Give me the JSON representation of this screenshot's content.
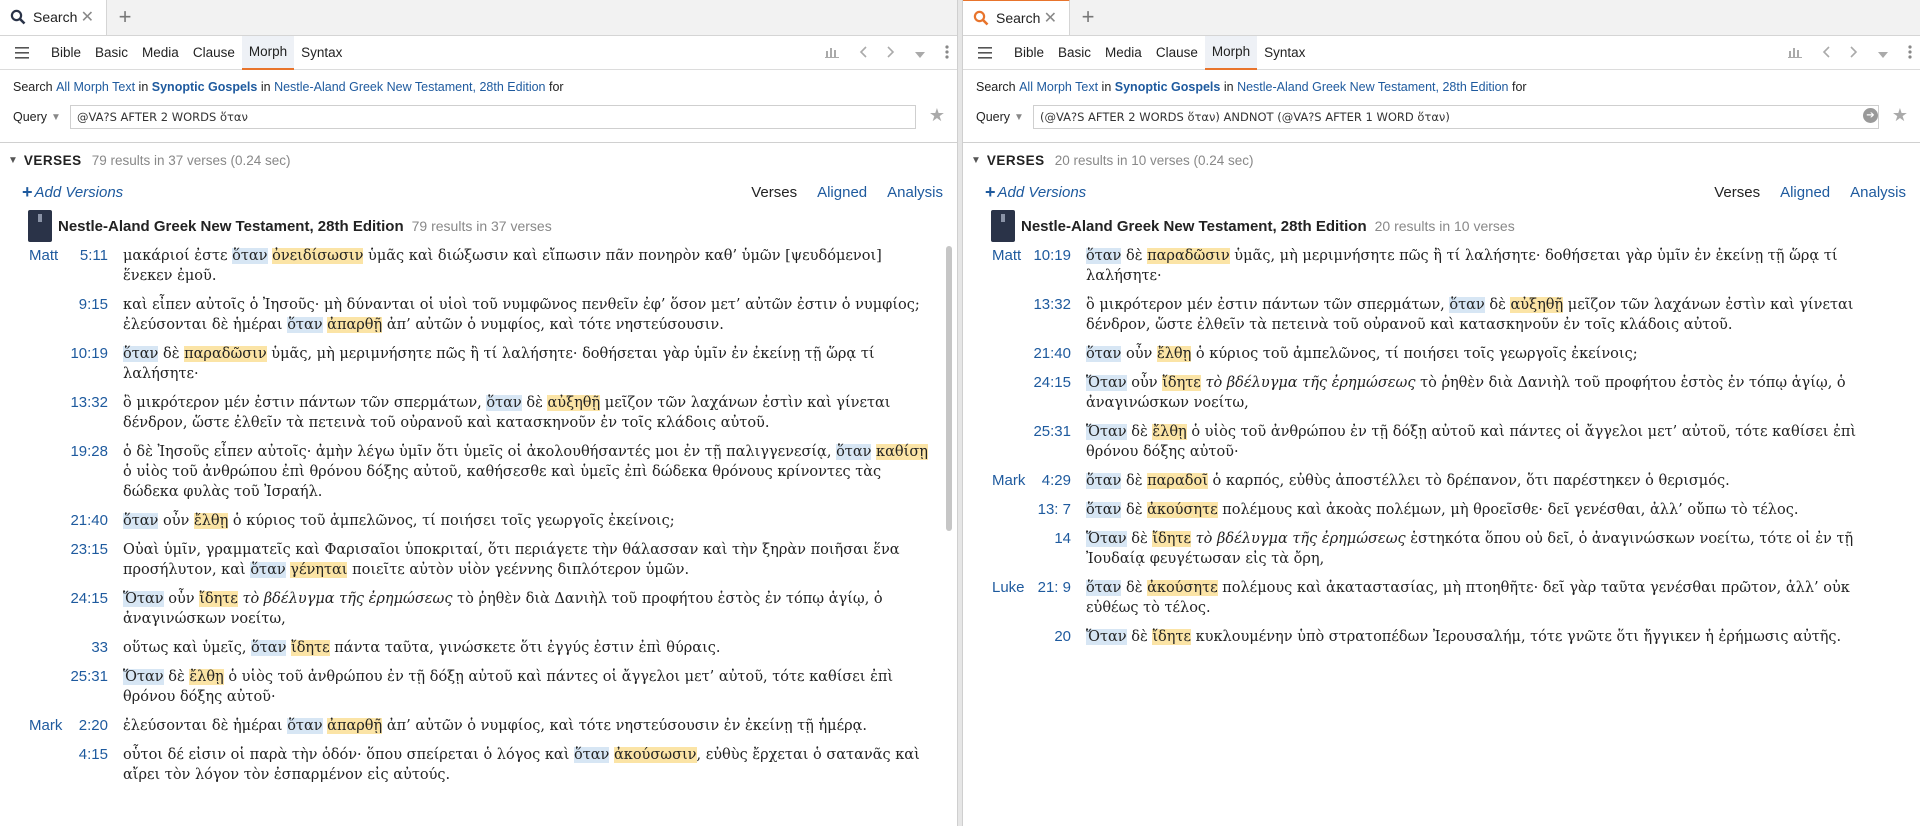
{
  "left": {
    "tab": {
      "label": "Search",
      "close": "✕",
      "new": "+"
    },
    "toolbar": {
      "tabs": [
        "Bible",
        "Basic",
        "Media",
        "Clause",
        "Morph",
        "Syntax"
      ],
      "active_tab": "Morph"
    },
    "search": {
      "prefix": "Search",
      "scope1": "All Morph Text",
      "in1": "in",
      "scope2": "Synoptic Gospels",
      "in2": "in",
      "scope3": "Nestle-Aland Greek New Testament, 28th Edition",
      "suffix": "for"
    },
    "query": {
      "label": "Query",
      "value": "@VA?S AFTER 2 WORDS ὅταν"
    },
    "section": {
      "title": "VERSES",
      "count": "79 results in 37 verses (0.24 sec)"
    },
    "versions": {
      "add": "Add Versions",
      "links": [
        "Verses",
        "Aligned",
        "Analysis"
      ]
    },
    "book": {
      "name": "Nestle-Aland Greek New Testament, 28th Edition",
      "count": "79 results in 37 verses"
    },
    "verses": [
      {
        "book": "Matt",
        "ref": "5:11",
        "parts": [
          [
            "μακάριοί ἐστε ",
            ""
          ],
          [
            "ὅταν",
            "b"
          ],
          [
            " ",
            ""
          ],
          [
            "ὀνειδίσωσιν",
            "y"
          ],
          [
            " ὑμᾶς καὶ διώξωσιν καὶ εἴπωσιν πᾶν πονηρὸν καθ’ ὑμῶν [ψευδόμενοι] ἕνεκεν ἐμοῦ.",
            ""
          ]
        ]
      },
      {
        "book": "",
        "ref": "9:15",
        "parts": [
          [
            "καὶ εἶπεν αὐτοῖς ὁ Ἰησοῦς· μὴ δύνανται οἱ υἱοὶ τοῦ νυμφῶνος πενθεῖν ἐφ’ ὅσον μετ’ αὐτῶν ἐστιν ὁ νυμφίος; ἐλεύσονται δὲ ἡμέραι ",
            ""
          ],
          [
            "ὅταν",
            "b"
          ],
          [
            " ",
            ""
          ],
          [
            "ἀπαρθῇ",
            "y"
          ],
          [
            " ἀπ’ αὐτῶν ὁ νυμφίος, καὶ τότε νηστεύσουσιν.",
            ""
          ]
        ]
      },
      {
        "book": "",
        "ref": "10:19",
        "parts": [
          [
            "ὅταν",
            "b"
          ],
          [
            " δὲ ",
            ""
          ],
          [
            "παραδῶσιν",
            "y"
          ],
          [
            " ὑμᾶς, μὴ μεριμνήσητε πῶς ἢ τί λαλήσητε· δοθήσεται γὰρ ὑμῖν ἐν ἐκείνῃ τῇ ὥρᾳ τί λαλήσητε·",
            ""
          ]
        ]
      },
      {
        "book": "",
        "ref": "13:32",
        "parts": [
          [
            "ὃ μικρότερον μέν ἐστιν πάντων τῶν σπερμάτων, ",
            ""
          ],
          [
            "ὅταν",
            "b"
          ],
          [
            " δὲ ",
            ""
          ],
          [
            "αὐξηθῇ",
            "y"
          ],
          [
            " μεῖζον τῶν λαχάνων ἐστὶν καὶ γίνεται δένδρον, ὥστε ἐλθεῖν τὰ πετεινὰ τοῦ οὐρανοῦ καὶ κατασκηνοῦν ἐν τοῖς κλάδοις αὐτοῦ.",
            ""
          ]
        ]
      },
      {
        "book": "",
        "ref": "19:28",
        "parts": [
          [
            "ὁ δὲ Ἰησοῦς εἶπεν αὐτοῖς· ἀμὴν λέγω ὑμῖν ὅτι ὑμεῖς οἱ ἀκολουθήσαντές μοι ἐν τῇ παλιγγενεσίᾳ, ",
            ""
          ],
          [
            "ὅταν",
            "b"
          ],
          [
            " ",
            ""
          ],
          [
            "καθίσῃ",
            "y"
          ],
          [
            " ὁ υἱὸς τοῦ ἀνθρώπου ἐπὶ θρόνου δόξης αὐτοῦ, καθήσεσθε καὶ ὑμεῖς ἐπὶ δώδεκα θρόνους κρίνοντες τὰς δώδεκα φυλὰς τοῦ Ἰσραήλ.",
            ""
          ]
        ]
      },
      {
        "book": "",
        "ref": "21:40",
        "parts": [
          [
            "ὅταν",
            "b"
          ],
          [
            " οὖν ",
            ""
          ],
          [
            "ἔλθῃ",
            "y"
          ],
          [
            " ὁ κύριος τοῦ ἀμπελῶνος, τί ποιήσει τοῖς γεωργοῖς ἐκείνοις;",
            ""
          ]
        ]
      },
      {
        "book": "",
        "ref": "23:15",
        "parts": [
          [
            "Οὐαὶ ὑμῖν, γραμματεῖς καὶ Φαρισαῖοι ὑποκριταί, ὅτι περιάγετε τὴν θάλασσαν καὶ τὴν ξηρὰν ποιῆσαι ἕνα προσήλυτον, καὶ ",
            ""
          ],
          [
            "ὅταν",
            "b"
          ],
          [
            " ",
            ""
          ],
          [
            "γένηται",
            "y"
          ],
          [
            " ποιεῖτε αὐτὸν υἱὸν γεέννης διπλότερον ὑμῶν.",
            ""
          ]
        ]
      },
      {
        "book": "",
        "ref": "24:15",
        "parts": [
          [
            "Ὅταν",
            "b"
          ],
          [
            " οὖν ",
            ""
          ],
          [
            "ἴδητε",
            "y"
          ],
          [
            " ",
            ""
          ],
          [
            "τὸ βδέλυγμα τῆς ἐρημώσεως",
            "i"
          ],
          [
            " τὸ ῥηθὲν διὰ Δανιὴλ τοῦ προφήτου ἑστὸς ἐν τόπῳ ἁγίῳ, ὁ ἀναγινώσκων νοείτω,",
            ""
          ]
        ]
      },
      {
        "book": "",
        "ref": "33",
        "parts": [
          [
            "οὕτως καὶ ὑμεῖς, ",
            ""
          ],
          [
            "ὅταν",
            "b"
          ],
          [
            " ",
            ""
          ],
          [
            "ἴδητε",
            "y"
          ],
          [
            " πάντα ταῦτα, γινώσκετε ὅτι ἐγγύς ἐστιν ἐπὶ θύραις.",
            ""
          ]
        ]
      },
      {
        "book": "",
        "ref": "25:31",
        "parts": [
          [
            "Ὅταν",
            "b"
          ],
          [
            " δὲ ",
            ""
          ],
          [
            "ἔλθῃ",
            "y"
          ],
          [
            " ὁ υἱὸς τοῦ ἀνθρώπου ἐν τῇ δόξῃ αὐτοῦ καὶ πάντες οἱ ἄγγελοι μετ’ αὐτοῦ, τότε καθίσει ἐπὶ θρόνου δόξης αὐτοῦ·",
            ""
          ]
        ]
      },
      {
        "book": "Mark",
        "ref": "2:20",
        "parts": [
          [
            "ἐλεύσονται δὲ ἡμέραι ",
            ""
          ],
          [
            "ὅταν",
            "b"
          ],
          [
            " ",
            ""
          ],
          [
            "ἀπαρθῇ",
            "y"
          ],
          [
            " ἀπ’ αὐτῶν ὁ νυμφίος, καὶ τότε νηστεύσουσιν ἐν ἐκείνῃ τῇ ἡμέρᾳ.",
            ""
          ]
        ]
      },
      {
        "book": "",
        "ref": "4:15",
        "parts": [
          [
            "οὗτοι δέ εἰσιν οἱ παρὰ τὴν ὁδόν· ὅπου σπείρεται ὁ λόγος καὶ ",
            ""
          ],
          [
            "ὅταν",
            "b"
          ],
          [
            " ",
            ""
          ],
          [
            "ἀκούσωσιν",
            "y"
          ],
          [
            ", εὐθὺς ἔρχεται ὁ σατανᾶς καὶ αἴρει τὸν λόγον τὸν ἐσπαρμένον εἰς αὐτούς.",
            ""
          ]
        ]
      }
    ]
  },
  "right": {
    "tab": {
      "label": "Search",
      "close": "✕",
      "new": "+"
    },
    "toolbar": {
      "tabs": [
        "Bible",
        "Basic",
        "Media",
        "Clause",
        "Morph",
        "Syntax"
      ],
      "active_tab": "Morph"
    },
    "search": {
      "prefix": "Search",
      "scope1": "All Morph Text",
      "in1": "in",
      "scope2": "Synoptic Gospels",
      "in2": "in",
      "scope3": "Nestle-Aland Greek New Testament, 28th Edition",
      "suffix": "for"
    },
    "query": {
      "label": "Query",
      "value": "(@VA?S AFTER 2 WORDS ὅταν) ANDNOT (@VA?S AFTER 1 WORD ὅταν)"
    },
    "section": {
      "title": "VERSES",
      "count": "20 results in 10 verses (0.24 sec)"
    },
    "versions": {
      "add": "Add Versions",
      "links": [
        "Verses",
        "Aligned",
        "Analysis"
      ]
    },
    "book": {
      "name": "Nestle-Aland Greek New Testament, 28th Edition",
      "count": "20 results in 10 verses"
    },
    "verses": [
      {
        "book": "Matt",
        "ref": "10:19",
        "parts": [
          [
            "ὅταν",
            "b"
          ],
          [
            " δὲ ",
            ""
          ],
          [
            "παραδῶσιν",
            "y"
          ],
          [
            " ὑμᾶς, μὴ μεριμνήσητε πῶς ἢ τί λαλήσητε· δοθήσεται γὰρ ὑμῖν ἐν ἐκείνῃ τῇ ὥρᾳ τί λαλήσητε·",
            ""
          ]
        ]
      },
      {
        "book": "",
        "ref": "13:32",
        "parts": [
          [
            "ὃ μικρότερον μέν ἐστιν πάντων τῶν σπερμάτων, ",
            ""
          ],
          [
            "ὅταν",
            "b"
          ],
          [
            " δὲ ",
            ""
          ],
          [
            "αὐξηθῇ",
            "y"
          ],
          [
            " μεῖζον τῶν λαχάνων ἐστὶν καὶ γίνεται δένδρον, ὥστε ἐλθεῖν τὰ πετεινὰ τοῦ οὐρανοῦ καὶ κατασκηνοῦν ἐν τοῖς κλάδοις αὐτοῦ.",
            ""
          ]
        ]
      },
      {
        "book": "",
        "ref": "21:40",
        "parts": [
          [
            "ὅταν",
            "b"
          ],
          [
            " οὖν ",
            ""
          ],
          [
            "ἔλθῃ",
            "y"
          ],
          [
            " ὁ κύριος τοῦ ἀμπελῶνος, τί ποιήσει τοῖς γεωργοῖς ἐκείνοις;",
            ""
          ]
        ]
      },
      {
        "book": "",
        "ref": "24:15",
        "parts": [
          [
            "Ὅταν",
            "b"
          ],
          [
            " οὖν ",
            ""
          ],
          [
            "ἴδητε",
            "y"
          ],
          [
            " ",
            ""
          ],
          [
            "τὸ βδέλυγμα τῆς ἐρημώσεως",
            "i"
          ],
          [
            " τὸ ῥηθὲν διὰ Δανιὴλ τοῦ προφήτου ἑστὸς ἐν τόπῳ ἁγίῳ, ὁ ἀναγινώσκων νοείτω,",
            ""
          ]
        ]
      },
      {
        "book": "",
        "ref": "25:31",
        "parts": [
          [
            "Ὅταν",
            "b"
          ],
          [
            " δὲ ",
            ""
          ],
          [
            "ἔλθῃ",
            "y"
          ],
          [
            " ὁ υἱὸς τοῦ ἀνθρώπου ἐν τῇ δόξῃ αὐτοῦ καὶ πάντες οἱ ἄγγελοι μετ’ αὐτοῦ, τότε καθίσει ἐπὶ θρόνου δόξης αὐτοῦ·",
            ""
          ]
        ]
      },
      {
        "book": "Mark",
        "ref": "4:29",
        "parts": [
          [
            "ὅταν",
            "b"
          ],
          [
            " δὲ ",
            ""
          ],
          [
            "παραδοῖ",
            "y"
          ],
          [
            " ὁ καρπός, εὐθὺς ἀποστέλλει τὸ δρέπανον, ὅτι παρέστηκεν ὁ θερισμός.",
            ""
          ]
        ]
      },
      {
        "book": "",
        "ref": "13: 7",
        "parts": [
          [
            "ὅταν",
            "b"
          ],
          [
            " δὲ ",
            ""
          ],
          [
            "ἀκούσητε",
            "y"
          ],
          [
            " πολέμους καὶ ἀκοὰς πολέμων, μὴ θροεῖσθε· δεῖ γενέσθαι, ἀλλ’ οὔπω τὸ τέλος.",
            ""
          ]
        ]
      },
      {
        "book": "",
        "ref": "14",
        "parts": [
          [
            "Ὅταν",
            "b"
          ],
          [
            " δὲ ",
            ""
          ],
          [
            "ἴδητε",
            "y"
          ],
          [
            " ",
            ""
          ],
          [
            "τὸ βδέλυγμα τῆς ἐρημώσεως",
            "i"
          ],
          [
            " ἑστηκότα ὅπου οὐ δεῖ, ὁ ἀναγινώσκων νοείτω, τότε οἱ ἐν τῇ Ἰουδαίᾳ φευγέτωσαν εἰς τὰ ὄρη,",
            ""
          ]
        ]
      },
      {
        "book": "Luke",
        "ref": "21: 9",
        "parts": [
          [
            "ὅταν",
            "b"
          ],
          [
            " δὲ ",
            ""
          ],
          [
            "ἀκούσητε",
            "y"
          ],
          [
            " πολέμους καὶ ἀκαταστασίας, μὴ πτοηθῆτε· δεῖ γὰρ ταῦτα γενέσθαι πρῶτον, ἀλλ’ οὐκ εὐθέως τὸ τέλος.",
            ""
          ]
        ]
      },
      {
        "book": "",
        "ref": "20",
        "parts": [
          [
            "Ὅταν",
            "b"
          ],
          [
            " δὲ ",
            ""
          ],
          [
            "ἴδητε",
            "y"
          ],
          [
            " κυκλουμένην ὑπὸ στρατοπέδων Ἰερουσαλήμ, τότε γνῶτε ὅτι ἤγγικεν ἡ ἐρήμωσις αὐτῆς.",
            ""
          ]
        ]
      }
    ]
  }
}
